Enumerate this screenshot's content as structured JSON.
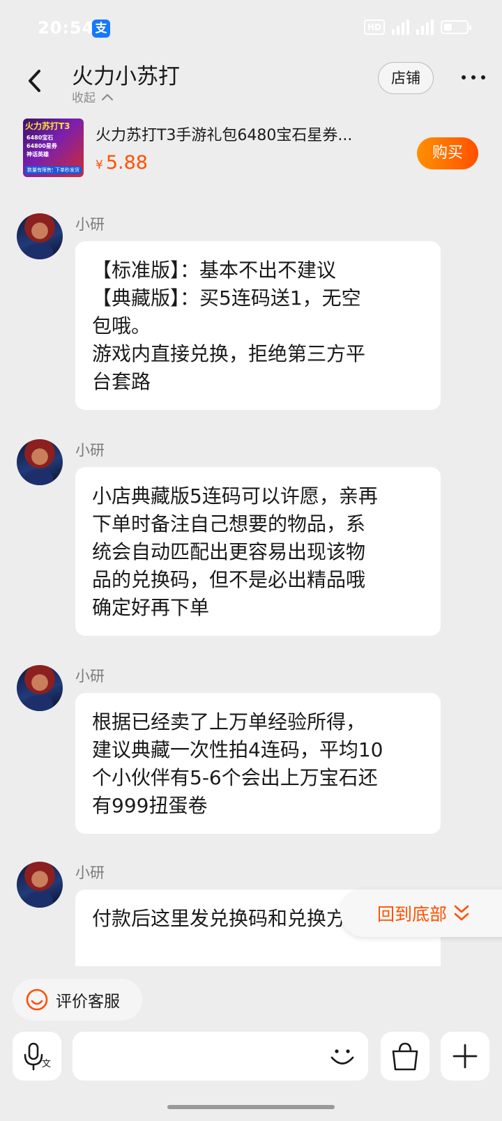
{
  "status_bar": {
    "time": "20:54",
    "app_icon": "支",
    "hd": "HD",
    "battery_level": 0.35
  },
  "header": {
    "title": "火力小苏打",
    "collapse_label": "收起",
    "store_button": "店铺"
  },
  "product": {
    "thumb_title": "火力苏打T3",
    "thumb_lines": [
      "6480宝石",
      "64800星券",
      "神话英雄"
    ],
    "thumb_footer_left": "数量有限售完即止",
    "thumb_footer_right": "下单秒发货",
    "name": "火力苏打T3手游礼包6480宝石星券...",
    "price_symbol": "¥",
    "price": "5.88",
    "buy_button": "购买"
  },
  "messages": [
    {
      "sender": "小研",
      "text": "【标准版】：基本不出不建议\n【典藏版】：买5连码送1，无空\n包哦。\n游戏内直接兑换，拒绝第三方平\n台套路"
    },
    {
      "sender": "小研",
      "text": "小店典藏版5连码可以许愿，亲再\n下单时备注自己想要的物品，系\n统会自动匹配出更容易出现该物\n品的兑换码，但不是必出精品哦\n确定好再下单"
    },
    {
      "sender": "小研",
      "text": "根据已经卖了上万单经验所得，\n建议典藏一次性拍4连码，平均10\n个小伙伴有5-6个会出上万宝石还\n有999扭蛋卷"
    },
    {
      "sender": "小研",
      "text": "付款后这里发兑换码和兑换方式"
    }
  ],
  "scroll_to_bottom": "回到底部",
  "review_chip": "评价客服",
  "icons": {
    "back": "back-arrow-icon",
    "more": "more-dots-icon",
    "voice": "voice-input-icon",
    "emoji": "emoji-icon",
    "bag": "shopping-bag-icon",
    "plus": "plus-icon",
    "smile": "smile-icon",
    "chevron": "double-chevron-down-icon"
  },
  "colors": {
    "accent": "#ff5000",
    "buy_gradient_start": "#ff9000",
    "background": "#ededed",
    "bubble": "#ffffff"
  }
}
